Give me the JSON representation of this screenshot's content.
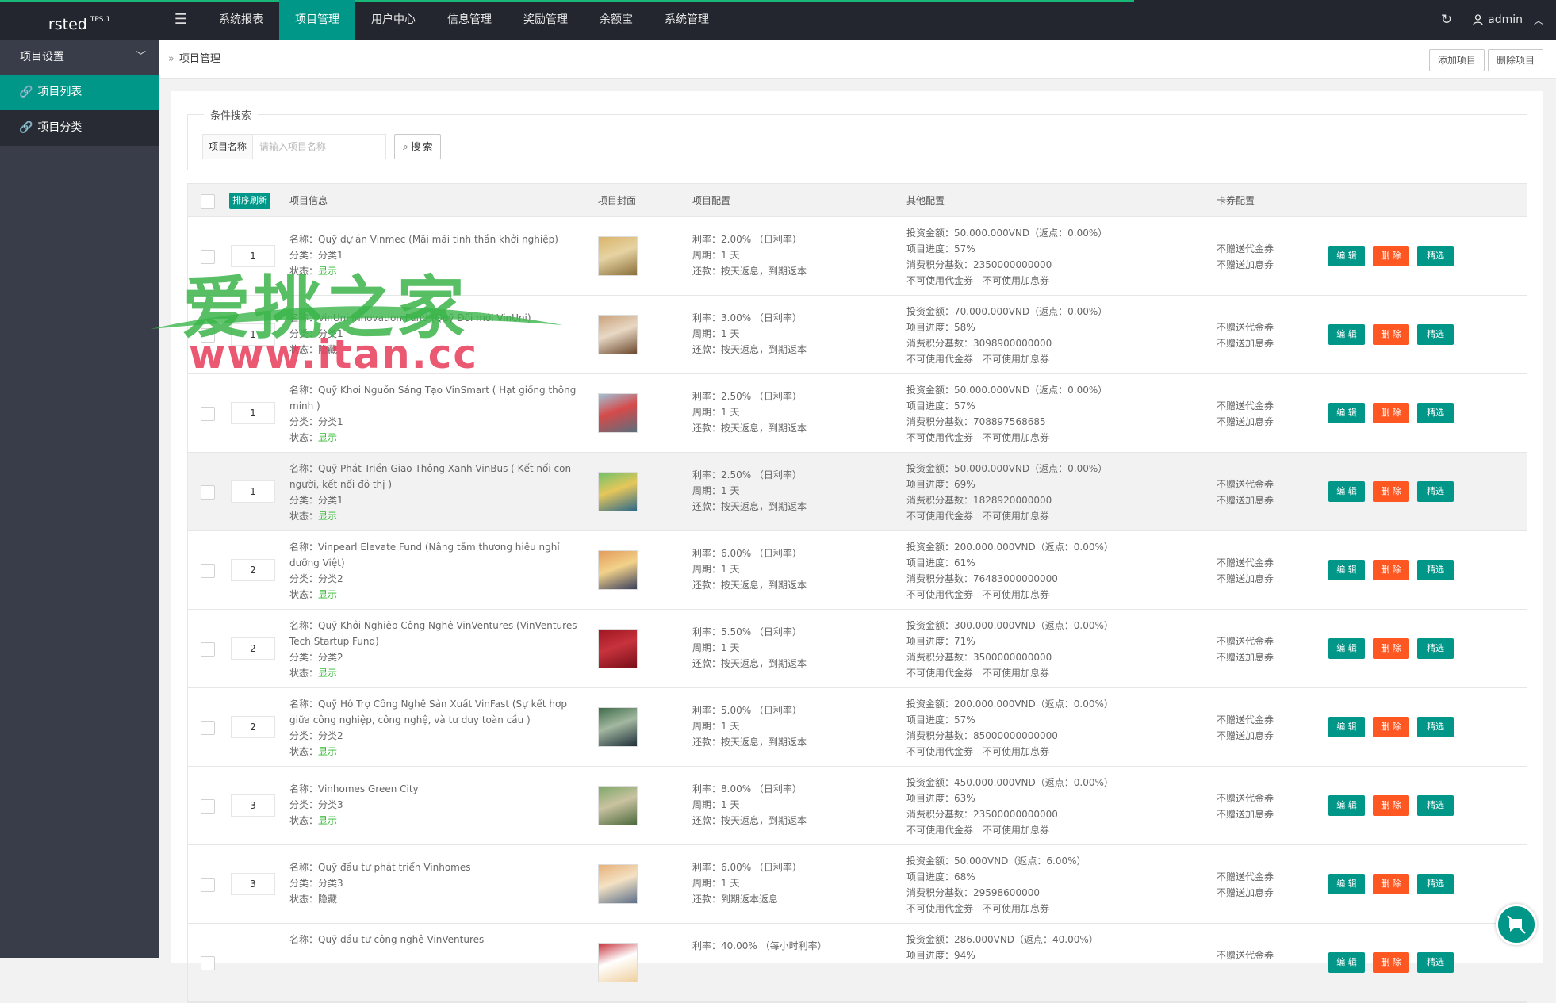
{
  "app": {
    "logo": "rsted",
    "version": "TPS.1"
  },
  "topnav": {
    "toggle_icon": "menu-icon",
    "items": [
      "系统报表",
      "项目管理",
      "用户中心",
      "信息管理",
      "奖励管理",
      "余额宝",
      "系统管理"
    ],
    "active": "项目管理",
    "user": "admin"
  },
  "sidebar": {
    "header": "项目设置",
    "items": [
      "项目列表",
      "项目分类"
    ]
  },
  "breadcrumb": "项目管理",
  "header_buttons": {
    "add": "添加项目",
    "delete": "删除项目"
  },
  "search": {
    "legend": "条件搜索",
    "label": "项目名称",
    "placeholder": "请输入项目名称",
    "button": "搜 索"
  },
  "table": {
    "sort_button": "排序刷新",
    "headers": {
      "info": "项目信息",
      "cover": "项目封面",
      "config": "项目配置",
      "other": "其他配置",
      "card": "卡券配置"
    },
    "ops": {
      "edit": "编 辑",
      "delete": "删 除",
      "pick": "精选"
    },
    "rows": [
      {
        "sort": "1",
        "name": "名称：Quỹ dự án Vinmec (Mãi mãi tinh thần khởi nghiệp)",
        "cat": "分类：分类1",
        "status_label": "状态：",
        "status": "显示",
        "rate": "利率：2.00% （日利率）",
        "period": "周期：1 天",
        "repay": "还款：按天返息，到期返本",
        "invest": "投资金额：50.000.000VND（返点：0.00%）",
        "progress": "项目进度：57%",
        "points": "消费积分基数：2350000000000",
        "coupon": "不可使用代金券　不可使用加息券",
        "card1": "不赠送代金券",
        "card2": "不赠送加息券",
        "cover_colors": [
          "#d9b46a",
          "#8a6f3a",
          "#e6d3a3"
        ]
      },
      {
        "sort": "1",
        "name": "名称：VinUni Innovation Fund (Quỹ Đổi mới VinUni)",
        "cat": "分类：分类1",
        "status_label": "状态：",
        "status": "隐藏",
        "rate": "利率：3.00% （日利率）",
        "period": "周期：1 天",
        "repay": "还款：按天返息，到期返本",
        "invest": "投资金额：70.000.000VND（返点：0.00%）",
        "progress": "项目进度：58%",
        "points": "消费积分基数：3098900000000",
        "coupon": "不可使用代金券　不可使用加息券",
        "card1": "不赠送代金券",
        "card2": "不赠送加息券",
        "cover_colors": [
          "#c9a27c",
          "#6d4a2f",
          "#e8d8c4"
        ]
      },
      {
        "sort": "1",
        "name": "名称：Quỹ Khơi Nguồn Sáng Tạo VinSmart ( Hạt giống thông minh )",
        "cat": "分类：分类1",
        "status_label": "状态：",
        "status": "显示",
        "rate": "利率：2.50% （日利率）",
        "period": "周期：1 天",
        "repay": "还款：按天返息，到期返本",
        "invest": "投资金额：50.000.000VND（返点：0.00%）",
        "progress": "项目进度：57%",
        "points": "消费积分基数：708897568685",
        "coupon": "不可使用代金券　不可使用加息券",
        "card1": "不赠送代金券",
        "card2": "不赠送加息券",
        "cover_colors": [
          "#9ec3d6",
          "#5a6f7d",
          "#d64a4a"
        ]
      },
      {
        "sort": "1",
        "name": "名称：Quỹ Phát Triển Giao Thông Xanh VinBus ( Kết nối con người, kết nối đô thị )",
        "cat": "分类：分类1",
        "status_label": "状态：",
        "status": "显示",
        "rate": "利率：2.50% （日利率）",
        "period": "周期：1 天",
        "repay": "还款：按天返息，到期返本",
        "invest": "投资金额：50.000.000VND（返点：0.00%）",
        "progress": "项目进度：69%",
        "points": "消费积分基数：1828920000000",
        "coupon": "不可使用代金券　不可使用加息券",
        "card1": "不赠送代金券",
        "card2": "不赠送加息券",
        "cover_colors": [
          "#6fc16b",
          "#2d6a8a",
          "#e6c75a"
        ]
      },
      {
        "sort": "2",
        "name": "名称：Vinpearl Elevate Fund (Nâng tầm thương hiệu nghỉ dưỡng Việt)",
        "cat": "分类：分类2",
        "status_label": "状态：",
        "status": "显示",
        "rate": "利率：6.00% （日利率）",
        "period": "周期：1 天",
        "repay": "还款：按天返息，到期返本",
        "invest": "投资金额：200.000.000VND（返点：0.00%）",
        "progress": "项目进度：61%",
        "points": "消费积分基数：76483000000000",
        "coupon": "不可使用代金券　不可使用加息券",
        "card1": "不赠送代金券",
        "card2": "不赠送加息券",
        "cover_colors": [
          "#e39b5a",
          "#3a3f5c",
          "#f2d28a"
        ]
      },
      {
        "sort": "2",
        "name": "名称：Quỹ Khởi Nghiệp Công Nghệ VinVentures (VinVentures Tech Startup Fund)",
        "cat": "分类：分类2",
        "status_label": "状态：",
        "status": "显示",
        "rate": "利率：5.50% （日利率）",
        "period": "周期：1 天",
        "repay": "还款：按天返息，到期返本",
        "invest": "投资金额：300.000.000VND（返点：0.00%）",
        "progress": "项目进度：71%",
        "points": "消费积分基数：3500000000000",
        "coupon": "不可使用代金券　不可使用加息券",
        "card1": "不赠送代金券",
        "card2": "不赠送加息券",
        "cover_colors": [
          "#9e1622",
          "#7a0f18",
          "#c7333d"
        ]
      },
      {
        "sort": "2",
        "name": "名称：Quỹ Hỗ Trợ Công Nghệ Sản Xuất VinFast (Sự kết hợp giữa công nghiệp, công nghệ, và tư duy toàn cầu )",
        "cat": "分类：分类2",
        "status_label": "状态：",
        "status": "显示",
        "rate": "利率：5.00% （日利率）",
        "period": "周期：1 天",
        "repay": "还款：按天返息，到期返本",
        "invest": "投资金额：200.000.000VND（返点：0.00%）",
        "progress": "项目进度：57%",
        "points": "消费积分基数：85000000000000",
        "coupon": "不可使用代金券　不可使用加息券",
        "card1": "不赠送代金券",
        "card2": "不赠送加息券",
        "cover_colors": [
          "#3f6b4a",
          "#1f2f3a",
          "#a3b8a0"
        ]
      },
      {
        "sort": "3",
        "name": "名称：Vinhomes Green City",
        "cat": "分类：分类3",
        "status_label": "状态：",
        "status": "显示",
        "rate": "利率：8.00% （日利率）",
        "period": "周期：1 天",
        "repay": "还款：按天返息，到期返本",
        "invest": "投资金额：450.000.000VND（返点：0.00%）",
        "progress": "项目进度：63%",
        "points": "消费积分基数：23500000000000",
        "coupon": "不可使用代金券　不可使用加息券",
        "card1": "不赠送代金券",
        "card2": "不赠送加息券",
        "cover_colors": [
          "#7fa86a",
          "#4d6b3d",
          "#c9c2a0"
        ]
      },
      {
        "sort": "3",
        "name": "名称：Quỹ đầu tư phát triển Vinhomes",
        "cat": "分类：分类3",
        "status_label": "状态：",
        "status": "隐藏",
        "rate": "利率：6.00% （日利率）",
        "period": "周期：1 天",
        "repay": "还款：到期返本返息",
        "invest": "投资金额：50.000VND（返点：6.00%）",
        "progress": "项目进度：68%",
        "points": "消费积分基数：29598600000",
        "coupon": "不可使用代金券　不可使用加息券",
        "card1": "不赠送代金券",
        "card2": "不赠送加息券",
        "cover_colors": [
          "#e8b07a",
          "#5c6f8a",
          "#f3e2c4"
        ]
      },
      {
        "sort": "",
        "name": "名称：Quỹ đầu tư công nghệ VinVentures",
        "cat": "",
        "status_label": "",
        "status": "",
        "rate": "利率：40.00% （每小时利率）",
        "period": "",
        "repay": "",
        "invest": "投资金额：286.000VND（返点：40.00%）",
        "progress": "项目进度：94%",
        "points": "",
        "coupon": "",
        "card1": "不赠送代金券",
        "card2": "",
        "cover_colors": [
          "#c7333d",
          "#f0d0a0",
          "#ffffff"
        ]
      }
    ]
  },
  "watermark": {
    "line1": "爱挑之家",
    "line2": "www.itan.cc"
  },
  "colors": {
    "primary": "#009688",
    "danger": "#ff5722",
    "topbar": "#23262e",
    "sidebar": "#393d49",
    "show": "#2eb82e"
  }
}
